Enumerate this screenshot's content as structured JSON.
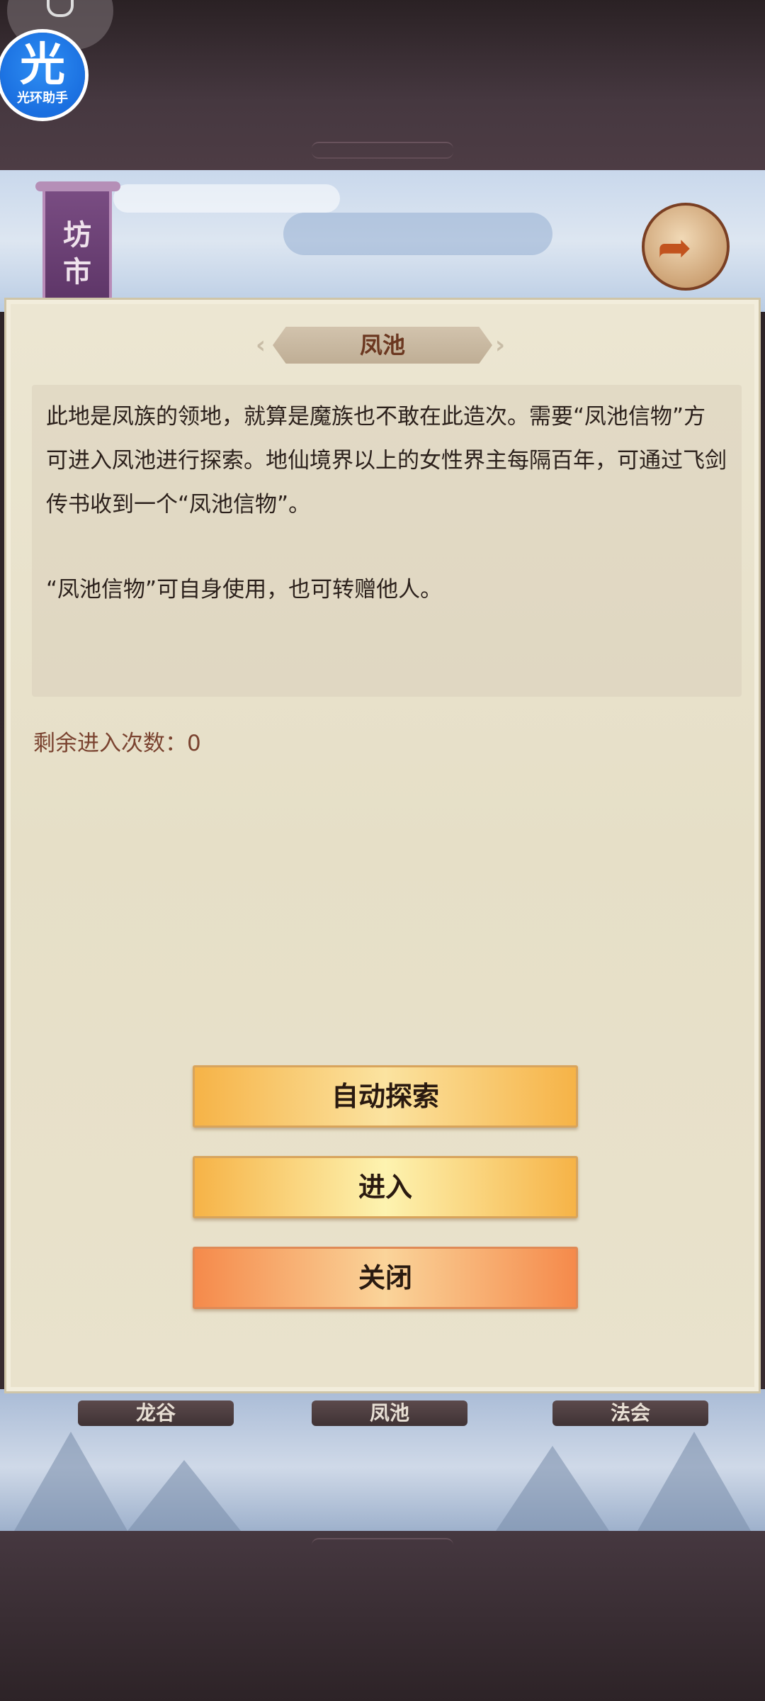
{
  "background": {
    "banner_text": "坊\n市",
    "tabs": [
      "龙谷",
      "凤池",
      "法会"
    ]
  },
  "overlay": {
    "app_badge_glyph": "光",
    "app_badge_label": "光环助手"
  },
  "dialog": {
    "title": "凤池",
    "description": "此地是凤族的领地，就算是魔族也不敢在此造次。需要“凤池信物”方可进入凤池进行探索。地仙境界以上的女性界主每隔百年，可通过飞剑传书收到一个“凤池信物”。",
    "description_2": "“凤池信物”可自身使用，也可转赠他人。",
    "remaining_entries": "剩余进入次数：0",
    "buttons": {
      "auto_explore": "自动探索",
      "enter": "进入",
      "close": "关闭"
    }
  },
  "colors": {
    "panel_bg": "#ece6d2",
    "title_text": "#6b3720",
    "remain_text": "#7a4330",
    "button_gold": "#f6b347",
    "button_orange": "#f58a4b"
  }
}
